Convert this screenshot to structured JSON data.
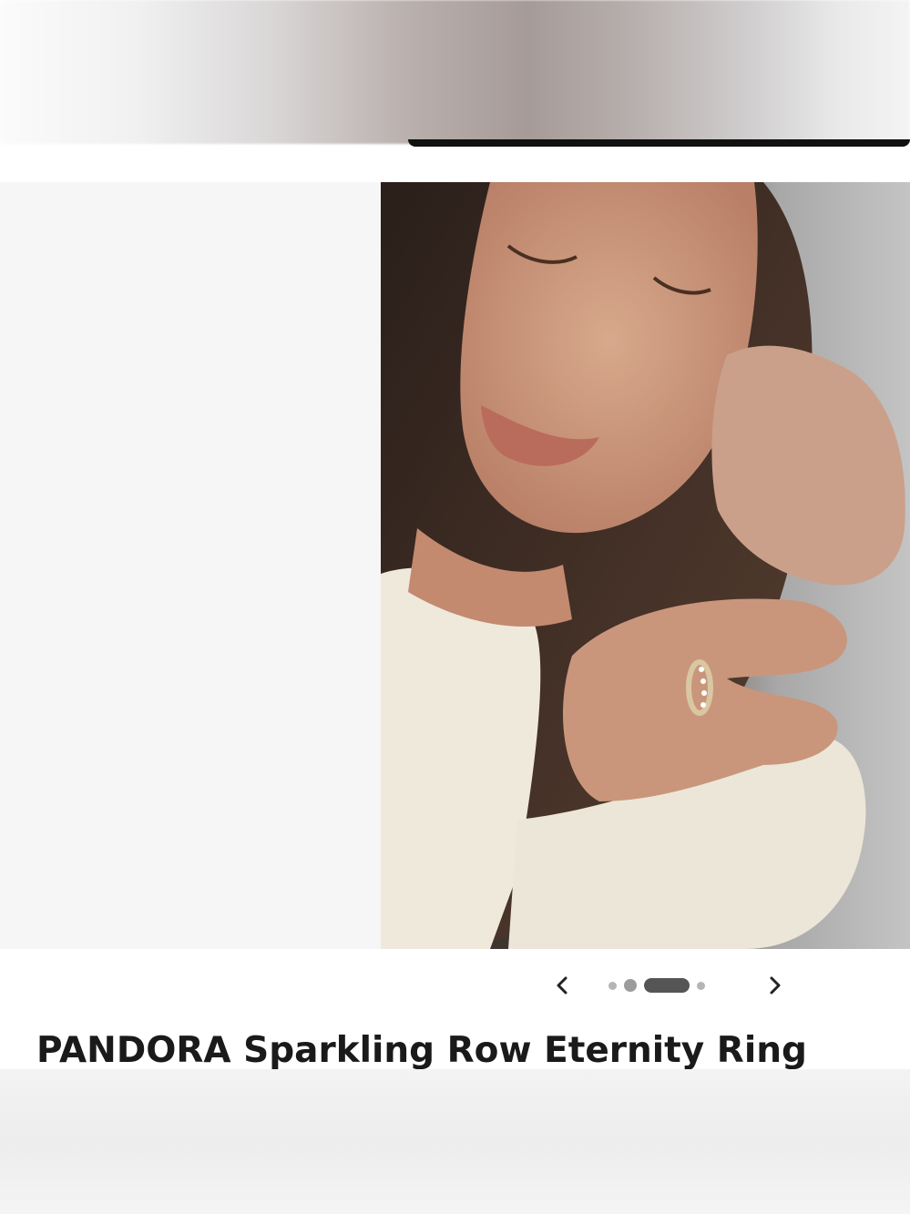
{
  "header": {
    "blurred": true
  },
  "gallery": {
    "image_alt": "Woman with freckles wearing a cream sweater and a sparkling eternity ring",
    "total_slides": 4,
    "active_slide": 3,
    "prev_icon": "chevron-left-icon",
    "next_icon": "chevron-right-icon"
  },
  "product": {
    "title": "PANDORA Sparkling Row Eternity Ring"
  },
  "colors": {
    "dot_inactive": "#b5b5b5",
    "dot_active": "#555555",
    "title_text": "#1a1a1a",
    "left_panel": "#f6f6f6"
  }
}
